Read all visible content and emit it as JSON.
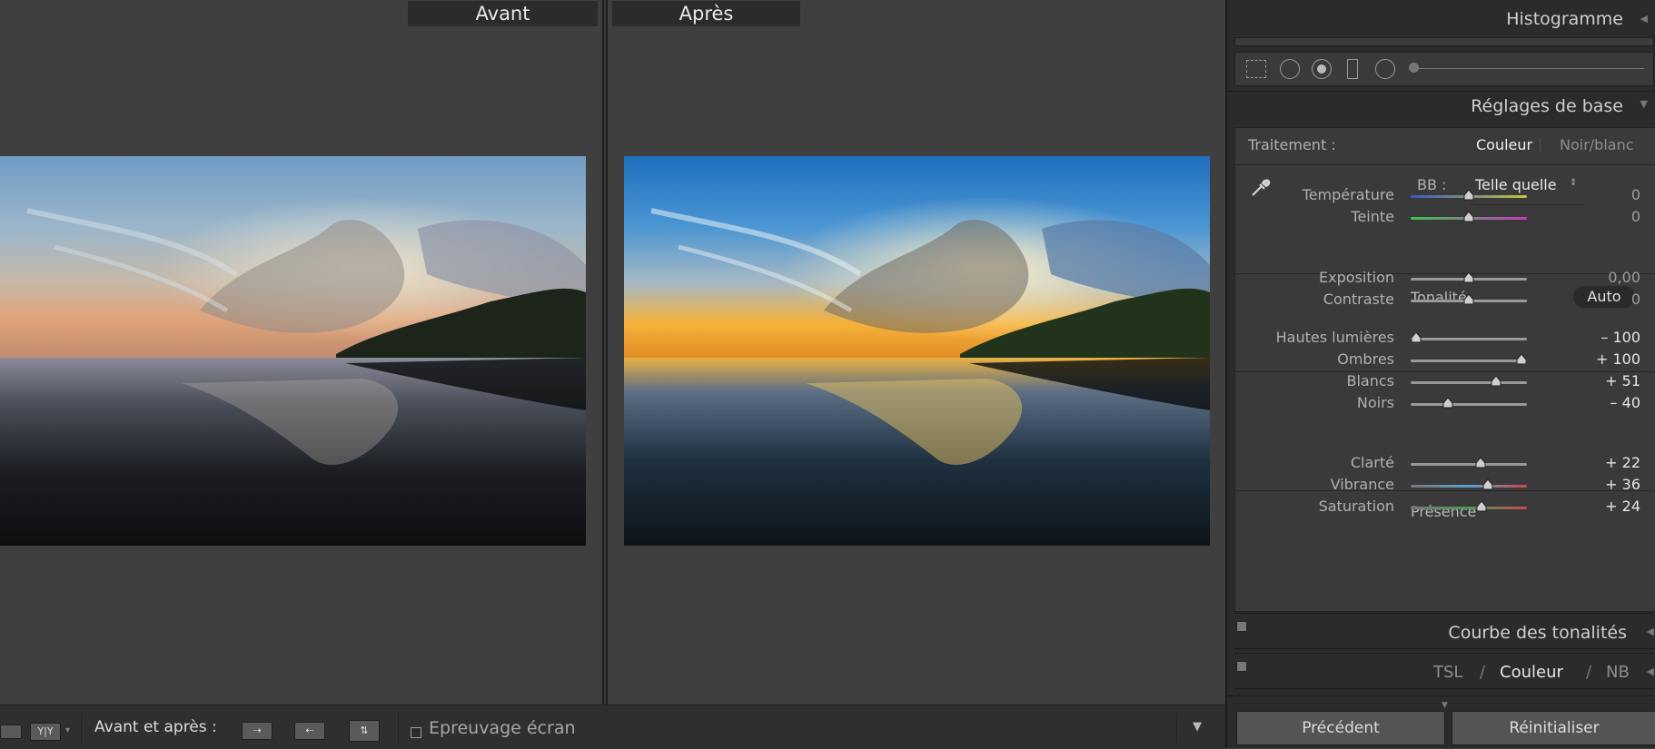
{
  "compare": {
    "before_label": "Avant",
    "after_label": "Après"
  },
  "toolbar": {
    "view_mode_label": "Y|Y",
    "mode_label": "Avant et après :",
    "soft_proof_label": "Epreuvage écran"
  },
  "panel": {
    "histogram": {
      "title": "Histogramme"
    },
    "basic": {
      "title": "Réglages de base",
      "treatment_label": "Traitement :",
      "treatment_color": "Couleur",
      "treatment_bw": "Noir/blanc",
      "wb_label": "BB :",
      "wb_value": "Telle quelle",
      "wb_sliders": [
        {
          "label": "Température",
          "value": "0",
          "position": 0.5
        },
        {
          "label": "Teinte",
          "value": "0",
          "position": 0.5
        }
      ],
      "tone_label": "Tonalité",
      "auto_label": "Auto",
      "tone_sliders": [
        {
          "label": "Exposition",
          "value": "0,00",
          "position": 0.5
        },
        {
          "label": "Contraste",
          "value": "0",
          "position": 0.5
        }
      ],
      "tone2_sliders": [
        {
          "label": "Hautes lumières",
          "value": "– 100",
          "position": 0.0
        },
        {
          "label": "Ombres",
          "value": "+ 100",
          "position": 1.0
        },
        {
          "label": "Blancs",
          "value": "+ 51",
          "position": 0.755
        },
        {
          "label": "Noirs",
          "value": "– 40",
          "position": 0.3
        }
      ],
      "presence_label": "Présence",
      "presence_sliders": [
        {
          "label": "Clarté",
          "value": "+ 22",
          "position": 0.61
        },
        {
          "label": "Vibrance",
          "value": "+ 36",
          "position": 0.68
        },
        {
          "label": "Saturation",
          "value": "+ 24",
          "position": 0.62
        }
      ]
    },
    "tone_curve": {
      "title": "Courbe des tonalités"
    },
    "hsl": {
      "tab_hsl": "TSL",
      "sep1": "/",
      "tab_color": "Couleur",
      "sep2": "/",
      "tab_bw": "NB"
    },
    "buttons": {
      "previous": "Précédent",
      "reset": "Réinitialiser"
    }
  }
}
